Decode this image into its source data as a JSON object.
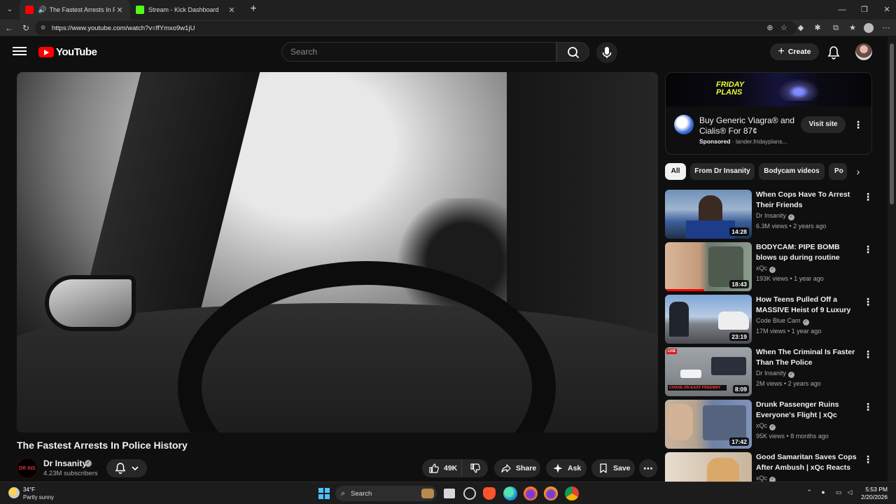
{
  "browser": {
    "tabs": [
      {
        "title": "The Fastest Arrests In Police History",
        "favicon_color": "#ff0000"
      },
      {
        "title": "Stream - Kick Dashboard",
        "favicon_color": "#53fc18"
      }
    ],
    "url": "https://www.youtube.com/watch?v=ffYmxo9w1jU"
  },
  "header": {
    "logo_text": "YouTube",
    "search_placeholder": "Search",
    "create_label": "Create"
  },
  "video": {
    "title": "The Fastest Arrests In Police History",
    "channel": "Dr Insanity",
    "subscribers": "4.23M subscribers",
    "avatar_text": "DR INS",
    "likes": "49K",
    "share_label": "Share",
    "ask_label": "Ask",
    "save_label": "Save"
  },
  "ad": {
    "banner_text": "FRIDAY PLANS",
    "title": "Buy Generic Viagra® and Cialis® For 87¢",
    "sponsored": "Sponsored",
    "domain": "lander.fridayplans...",
    "cta": "Visit site"
  },
  "chips": [
    "All",
    "From Dr Insanity",
    "Bodycam videos",
    "Po"
  ],
  "recommendations": [
    {
      "title": "When Cops Have To Arrest Their Friends",
      "channel": "Dr Insanity",
      "views": "6.3M views",
      "age": "2 years ago",
      "duration": "14:28",
      "progress": 0
    },
    {
      "title": "BODYCAM: PIPE BOMB blows up during routine traffic stop | ...",
      "channel": "xQc",
      "views": "193K views",
      "age": "1 year ago",
      "duration": "18:43",
      "progress": 0.45
    },
    {
      "title": "How Teens Pulled Off a MASSIVE Heist of 9 Luxury Cars",
      "channel": "Code Blue Cam",
      "views": "17M views",
      "age": "1 year ago",
      "duration": "23:19",
      "progress": 0
    },
    {
      "title": "When The Criminal Is Faster Than The Police",
      "channel": "Dr Insanity",
      "views": "2M views",
      "age": "2 years ago",
      "duration": "8:09",
      "progress": 0
    },
    {
      "title": "Drunk Passenger Ruins Everyone's Flight | xQc Reacts",
      "channel": "xQc",
      "views": "95K views",
      "age": "8 months ago",
      "duration": "17:42",
      "progress": 0
    },
    {
      "title": "Good Samaritan Saves Cops After Ambush | xQc Reacts",
      "channel": "xQc",
      "views": "",
      "age": "",
      "duration": "",
      "progress": 0
    }
  ],
  "thumb_overlays": {
    "chase_caption": "CHASE ON EAST FREEWAY",
    "live_badge": "LIVE"
  },
  "taskbar": {
    "temp": "34°F",
    "weather": "Partly sunny",
    "search_label": "Search",
    "time": "5:53 PM",
    "date": "2/20/2026"
  }
}
